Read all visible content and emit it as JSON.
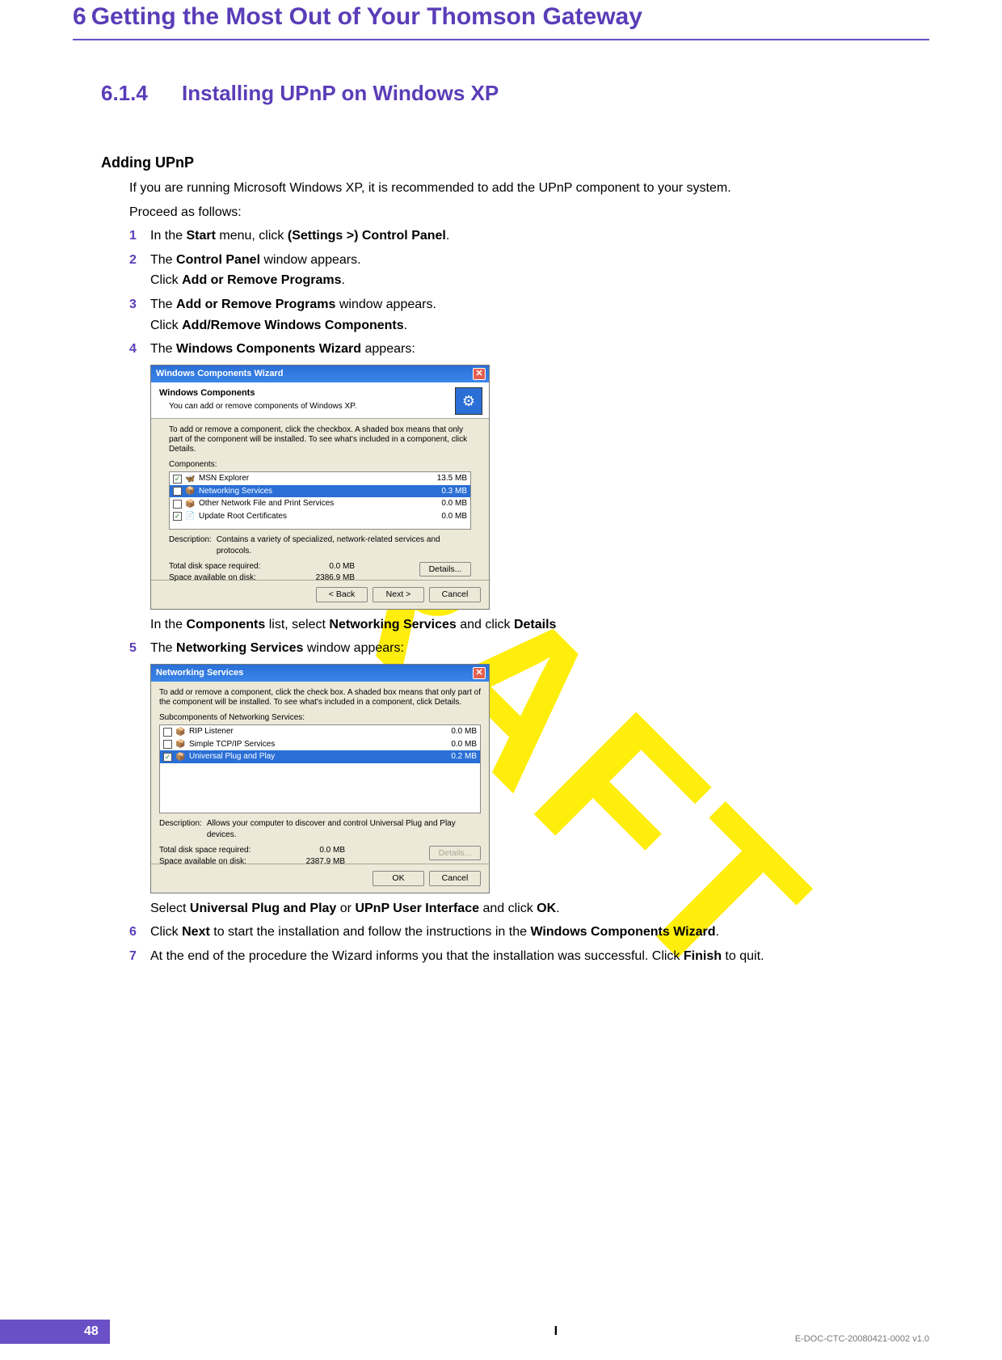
{
  "watermark": "DRAFT",
  "chapter": {
    "num": "6",
    "title": "Getting the Most Out of Your Thomson Gateway"
  },
  "section": {
    "num": "6.1.4",
    "title": "Installing UPnP on Windows XP"
  },
  "sub1": "Adding UPnP",
  "intro1": "If you are running Microsoft Windows XP, it is recommended to add the UPnP component to your system.",
  "intro2": "Proceed as follows:",
  "steps": {
    "s1": {
      "n": "1",
      "a": "In the ",
      "b1": "Start",
      "c": " menu, click ",
      "b2": "(Settings >) Control Panel",
      "d": "."
    },
    "s2": {
      "n": "2",
      "a": "The ",
      "b1": "Control Panel",
      "c": " window appears.",
      "l2a": "Click ",
      "l2b": "Add or Remove Programs",
      "l2c": "."
    },
    "s3": {
      "n": "3",
      "a": "The ",
      "b1": "Add or Remove Programs",
      "c": " window appears.",
      "l2a": "Click ",
      "l2b": "Add/Remove Windows Components",
      "l2c": "."
    },
    "s4": {
      "n": "4",
      "a": "The ",
      "b1": "Windows Components Wizard",
      "c": " appears:",
      "after_a": "In the ",
      "after_b1": "Components",
      "after_c": " list, select ",
      "after_b2": "Networking Services",
      "after_d": " and click ",
      "after_b3": "Details"
    },
    "s5": {
      "n": "5",
      "a": "The ",
      "b1": "Networking Services",
      "c": " window appears:",
      "after_a": "Select ",
      "after_b1": "Universal Plug and Play",
      "after_c": " or ",
      "after_b2": "UPnP User Interface",
      "after_d": " and click ",
      "after_b3": "OK",
      "after_e": "."
    },
    "s6": {
      "n": "6",
      "a": "Click ",
      "b1": "Next",
      "c": " to start the installation and follow the instructions in the ",
      "b2": "Windows Components Wizard",
      "d": "."
    },
    "s7": {
      "n": "7",
      "a": "At the end of the procedure the Wizard informs you that the installation was successful. Click ",
      "b1": "Finish",
      "c": " to quit."
    }
  },
  "wcw": {
    "title": "Windows Components Wizard",
    "hdr_title": "Windows Components",
    "hdr_sub": "You can add or remove components of Windows XP.",
    "instr": "To add or remove a component, click the checkbox. A shaded box means that only part of the component will be installed. To see what's included in a component, click Details.",
    "comp_label": "Components:",
    "rows": [
      {
        "check": "✓",
        "icon": "🦋",
        "name": "MSN Explorer",
        "size": "13.5 MB",
        "sel": false
      },
      {
        "check": "",
        "icon": "📦",
        "name": "Networking Services",
        "size": "0.3 MB",
        "sel": true
      },
      {
        "check": "",
        "icon": "📦",
        "name": "Other Network File and Print Services",
        "size": "0.0 MB",
        "sel": false
      },
      {
        "check": "✓",
        "icon": "📄",
        "name": "Update Root Certificates",
        "size": "0.0 MB",
        "sel": false
      }
    ],
    "desc_label": "Description:",
    "desc": "Contains a variety of specialized, network-related services and protocols.",
    "total_label": "Total disk space required:",
    "total_val": "0.0 MB",
    "avail_label": "Space available on disk:",
    "avail_val": "2386.9 MB",
    "details_btn": "Details...",
    "back_btn": "< Back",
    "next_btn": "Next >",
    "cancel_btn": "Cancel"
  },
  "ns": {
    "title": "Networking Services",
    "instr": "To add or remove a component, click the check box. A shaded box means that only part of the component will be installed. To see what's included in a component, click Details.",
    "sub_label": "Subcomponents of Networking Services:",
    "rows": [
      {
        "check": "",
        "icon": "📦",
        "name": "RIP Listener",
        "size": "0.0 MB",
        "sel": false
      },
      {
        "check": "",
        "icon": "📦",
        "name": "Simple TCP/IP Services",
        "size": "0.0 MB",
        "sel": false
      },
      {
        "check": "✓",
        "icon": "📦",
        "name": "Universal Plug and Play",
        "size": "0.2 MB",
        "sel": true
      }
    ],
    "desc_label": "Description:",
    "desc": "Allows your computer to discover and control Universal Plug and Play devices.",
    "total_label": "Total disk space required:",
    "total_val": "0.0 MB",
    "avail_label": "Space available on disk:",
    "avail_val": "2387.9 MB",
    "details_btn": "Details...",
    "ok_btn": "OK",
    "cancel_btn": "Cancel"
  },
  "footer": {
    "page": "48",
    "doc": "E-DOC-CTC-20080421-0002 v1.0",
    "center": "I"
  }
}
